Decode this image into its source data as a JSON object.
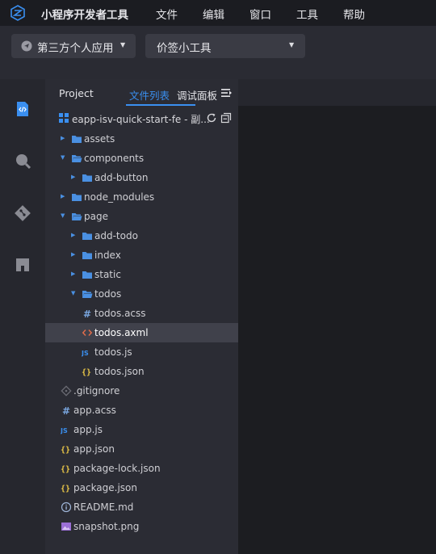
{
  "app": {
    "title": "小程序开发者工具",
    "menu": [
      "文件",
      "编辑",
      "窗口",
      "工具",
      "帮助"
    ]
  },
  "toolbar": {
    "app_select": "第三方个人应用",
    "tool_select": "价签小工具"
  },
  "activity": [
    "code-icon",
    "search-icon",
    "git-icon",
    "extensions-icon"
  ],
  "panel": {
    "tabs": [
      "Project",
      "文件列表",
      "调试面板"
    ],
    "active_tab": "文件列表",
    "project_name": "eapp-isv-quick-start-fe - 副..."
  },
  "tree": [
    {
      "label": "assets",
      "type": "folder",
      "expanded": false
    },
    {
      "label": "components",
      "type": "folder",
      "expanded": true
    },
    {
      "label": "add-button",
      "type": "folder",
      "expanded": false
    },
    {
      "label": "node_modules",
      "type": "folder",
      "expanded": false
    },
    {
      "label": "page",
      "type": "folder",
      "expanded": true
    },
    {
      "label": "add-todo",
      "type": "folder",
      "expanded": false
    },
    {
      "label": "index",
      "type": "folder",
      "expanded": false
    },
    {
      "label": "static",
      "type": "folder",
      "expanded": false
    },
    {
      "label": "todos",
      "type": "folder",
      "expanded": true
    },
    {
      "label": "todos.acss",
      "type": "acss"
    },
    {
      "label": "todos.axml",
      "type": "axml",
      "selected": true
    },
    {
      "label": "todos.js",
      "type": "js"
    },
    {
      "label": "todos.json",
      "type": "json"
    },
    {
      "label": ".gitignore",
      "type": "git"
    },
    {
      "label": "app.acss",
      "type": "acss"
    },
    {
      "label": "app.js",
      "type": "js"
    },
    {
      "label": "app.json",
      "type": "json"
    },
    {
      "label": "package-lock.json",
      "type": "json"
    },
    {
      "label": "package.json",
      "type": "json"
    },
    {
      "label": "README.md",
      "type": "info"
    },
    {
      "label": "snapshot.png",
      "type": "image"
    }
  ],
  "colors": {
    "accent": "#3a8ff0",
    "folder": "#4a90e2",
    "json": "#e8c547",
    "axml": "#e06c4a",
    "selected_row": "#40414b"
  }
}
